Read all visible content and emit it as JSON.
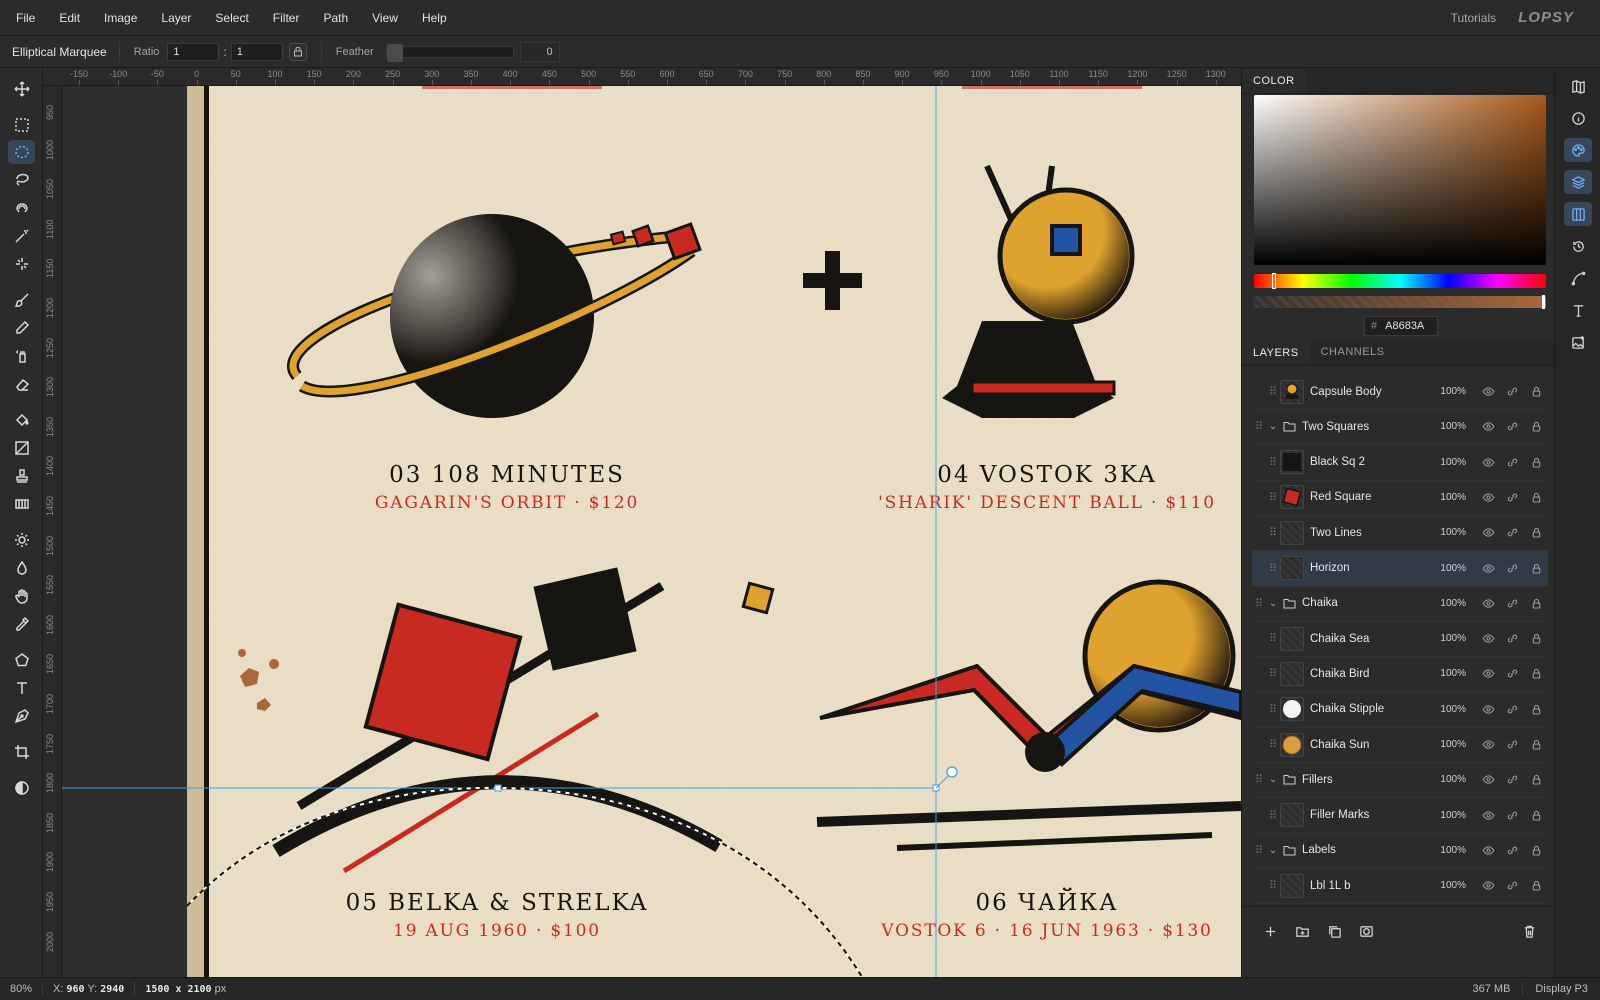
{
  "menubar": {
    "items": [
      "File",
      "Edit",
      "Image",
      "Layer",
      "Select",
      "Filter",
      "Path",
      "View",
      "Help"
    ],
    "tutorials": "Tutorials",
    "brand": "LOPSY"
  },
  "options": {
    "tool_name": "Elliptical Marquee",
    "ratio_label": "Ratio",
    "ratio_a": "1",
    "ratio_b": "1",
    "ratio_colon": ":",
    "feather_label": "Feather",
    "feather_value": "0"
  },
  "ruler": {
    "h_labels": [
      "-150",
      "-100",
      "-50",
      "0",
      "50",
      "100",
      "150",
      "200",
      "250",
      "300",
      "350",
      "400",
      "450",
      "500",
      "550",
      "600",
      "650",
      "700",
      "750",
      "800",
      "850",
      "900",
      "950",
      "1000",
      "1050",
      "1100",
      "1150",
      "1200",
      "1250",
      "1300"
    ],
    "v_labels": [
      "950",
      "1000",
      "1050",
      "1100",
      "1150",
      "1200",
      "1250",
      "1300",
      "1350",
      "1400",
      "1450",
      "1500",
      "1550",
      "1600",
      "1650",
      "1700",
      "1750",
      "1800",
      "1850",
      "1900",
      "1950",
      "2000"
    ]
  },
  "artwork": {
    "item03_title": "03  108 MINUTES",
    "item03_sub": "GAGARIN'S ORBIT  ·  $120",
    "item04_title": "04  VOSTOK 3KA",
    "item04_sub": "'SHARIK' DESCENT BALL  ·  $110",
    "item05_title": "05  BELKA & STRELKA",
    "item05_sub": "19 AUG 1960  ·  $100",
    "item06_title": "06  ЧАЙКА",
    "item06_sub": "VOSTOK 6  ·  16 JUN 1963  ·  $130",
    "colors": {
      "paper": "#ece2cb",
      "ink": "#171512",
      "red": "#c82a22",
      "yellow": "#e0a22e",
      "blue": "#2354a3",
      "rust": "#a8683a"
    }
  },
  "color_panel": {
    "tab": "COLOR",
    "hash": "#",
    "hex": "A8683A"
  },
  "layers_panel": {
    "tabs": [
      "LAYERS",
      "CHANNELS"
    ],
    "rows": [
      {
        "name": "Capsule Body",
        "opacity": "100%",
        "type": "layer",
        "thumb": "capsule"
      },
      {
        "name": "Two Squares",
        "opacity": "100%",
        "type": "group"
      },
      {
        "name": "Black Sq 2",
        "opacity": "100%",
        "type": "layer",
        "thumb": "black"
      },
      {
        "name": "Red Square",
        "opacity": "100%",
        "type": "layer",
        "thumb": "red"
      },
      {
        "name": "Two Lines",
        "opacity": "100%",
        "type": "layer",
        "thumb": "empty"
      },
      {
        "name": "Horizon",
        "opacity": "100%",
        "type": "layer",
        "thumb": "empty",
        "selected": true
      },
      {
        "name": "Chaika",
        "opacity": "100%",
        "type": "group"
      },
      {
        "name": "Chaika Sea",
        "opacity": "100%",
        "type": "layer",
        "thumb": "empty"
      },
      {
        "name": "Chaika Bird",
        "opacity": "100%",
        "type": "layer",
        "thumb": "empty"
      },
      {
        "name": "Chaika Stipple",
        "opacity": "100%",
        "type": "layer",
        "thumb": "white"
      },
      {
        "name": "Chaika Sun",
        "opacity": "100%",
        "type": "layer",
        "thumb": "sun"
      },
      {
        "name": "Fillers",
        "opacity": "100%",
        "type": "group"
      },
      {
        "name": "Filler Marks",
        "opacity": "100%",
        "type": "layer",
        "thumb": "empty"
      },
      {
        "name": "Labels",
        "opacity": "100%",
        "type": "group"
      },
      {
        "name": "Lbl 1L b",
        "opacity": "100%",
        "type": "layer",
        "thumb": "empty"
      }
    ]
  },
  "status": {
    "zoom": "80%",
    "x_label": "X:",
    "x": "960",
    "y_label": "Y:",
    "y": "2940",
    "doc_size": "1500 x 2100",
    "doc_unit": "px",
    "memory": "367 MB",
    "profile": "Display P3"
  }
}
